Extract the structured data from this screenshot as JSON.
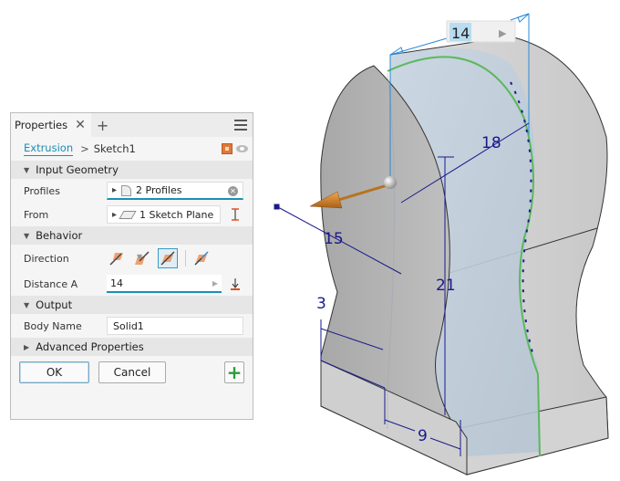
{
  "panel": {
    "tab_label": "Properties",
    "close_glyph": "✕",
    "add_glyph": "+",
    "breadcrumb": {
      "feature": "Extrusion",
      "separator": ">",
      "sketch": "Sketch1"
    },
    "sections": {
      "input_geometry": "Input Geometry",
      "behavior": "Behavior",
      "output": "Output",
      "advanced": "Advanced Properties"
    },
    "fields": {
      "profiles_label": "Profiles",
      "profiles_value": "2 Profiles",
      "from_label": "From",
      "from_value": "1 Sketch Plane",
      "direction_label": "Direction",
      "direction_selected": "symmetric",
      "distance_label": "Distance A",
      "distance_value": "14",
      "body_name_label": "Body Name",
      "body_name_value": "Solid1"
    },
    "buttons": {
      "ok": "OK",
      "cancel": "Cancel"
    },
    "caret_open": "▼",
    "caret_closed": "▶"
  },
  "viewport": {
    "distance_input": "14",
    "distance_arrow": "▶",
    "dimensions": {
      "d1": "18",
      "d2": "15",
      "d3": "21",
      "d4": "3",
      "d5": "9"
    },
    "colors": {
      "sketch_dim": "#1a1a8c",
      "preview_dim": "#2a8ad8",
      "arrow": "#d4862a",
      "edge_highlight": "#5cb85c"
    }
  }
}
